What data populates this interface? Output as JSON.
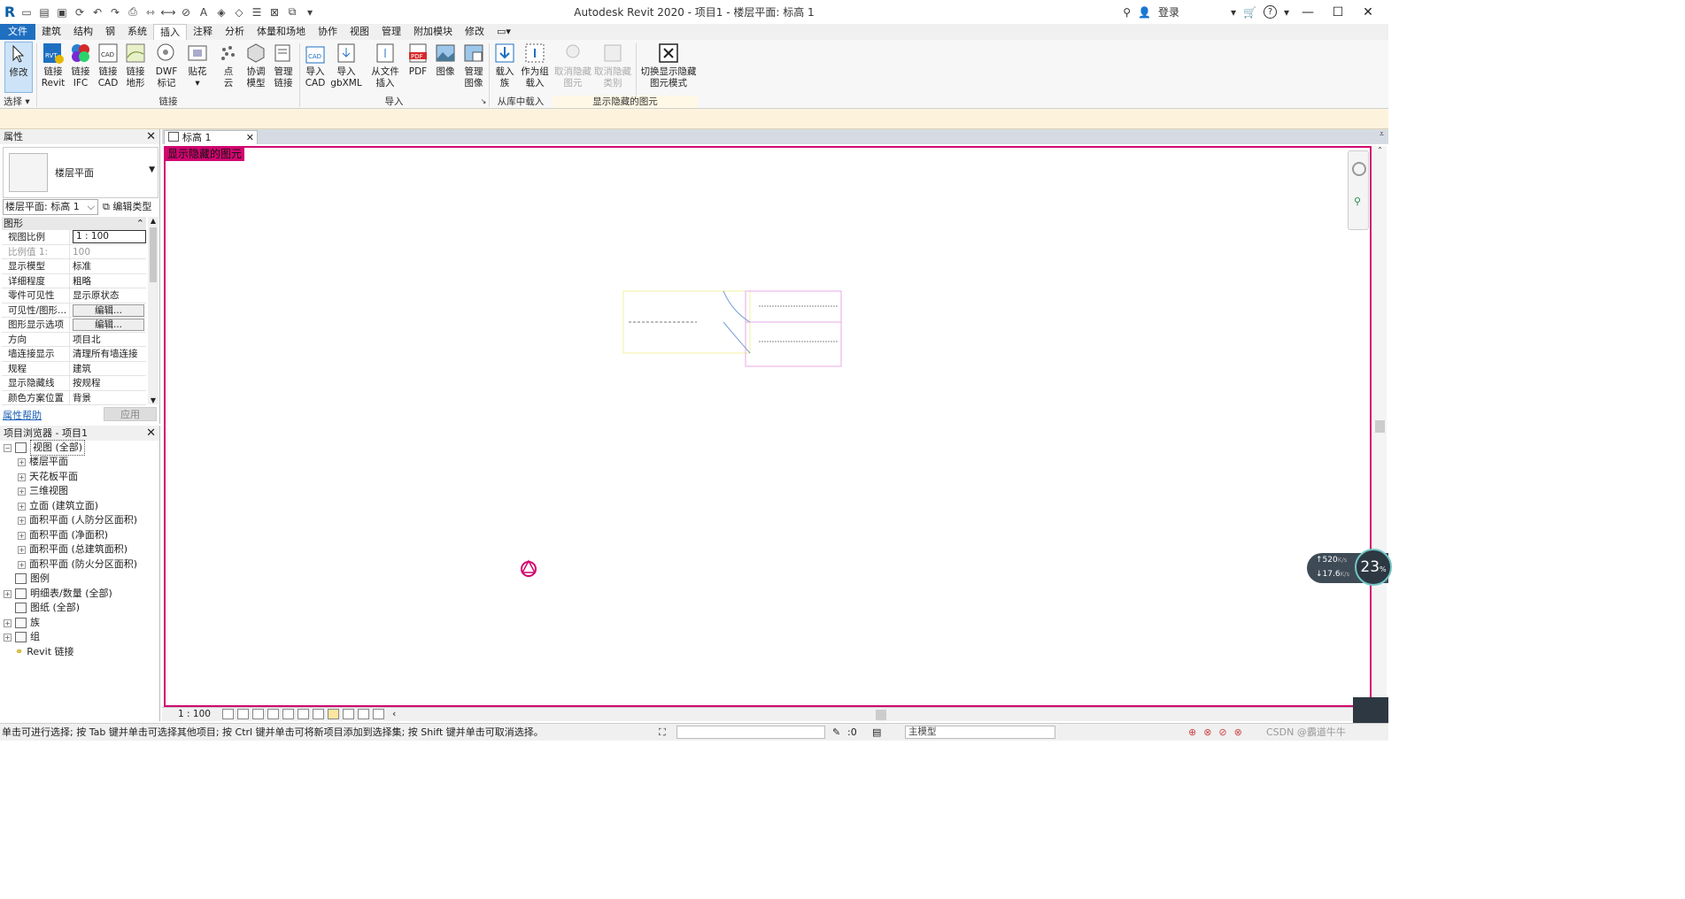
{
  "titlebar": {
    "title": "Autodesk Revit 2020 - 项目1 - 楼层平面: 标高 1",
    "login": "登录",
    "help": "?"
  },
  "tabs": [
    "文件",
    "建筑",
    "结构",
    "钢",
    "系统",
    "插入",
    "注释",
    "分析",
    "体量和场地",
    "协作",
    "视图",
    "管理",
    "附加模块",
    "修改"
  ],
  "ribbon": {
    "modify": "修改",
    "select_label": "选择",
    "buttons": [
      {
        "id": "link-revit",
        "label1": "链接",
        "label2": "Revit"
      },
      {
        "id": "link-ifc",
        "label1": "链接",
        "label2": "IFC"
      },
      {
        "id": "link-cad",
        "label1": "链接",
        "label2": "CAD"
      },
      {
        "id": "link-topo",
        "label1": "链接",
        "label2": "地形"
      },
      {
        "id": "dwf",
        "label1": "DWF",
        "label2": "标记"
      },
      {
        "id": "decal",
        "label1": "贴花",
        "label2": ""
      },
      {
        "id": "point-cloud",
        "label1": "点",
        "label2": "云"
      },
      {
        "id": "coord-model",
        "label1": "协调",
        "label2": "模型"
      },
      {
        "id": "manage-links",
        "label1": "管理",
        "label2": "链接"
      },
      {
        "id": "import-cad",
        "label1": "导入",
        "label2": "CAD"
      },
      {
        "id": "import-gbxml",
        "label1": "导入",
        "label2": "gbXML"
      },
      {
        "id": "insert-from-file",
        "label1": "从文件",
        "label2": "插入"
      },
      {
        "id": "pdf",
        "label1": "PDF",
        "label2": ""
      },
      {
        "id": "image",
        "label1": "图像",
        "label2": ""
      },
      {
        "id": "manage-images",
        "label1": "管理",
        "label2": "图像"
      },
      {
        "id": "load-family",
        "label1": "载入",
        "label2": "族"
      },
      {
        "id": "load-as-group",
        "label1": "作为组",
        "label2": "载入"
      },
      {
        "id": "unhide-element",
        "label1": "取消隐藏",
        "label2": "图元"
      },
      {
        "id": "unhide-category",
        "label1": "取消隐藏",
        "label2": "类别"
      },
      {
        "id": "toggle-reveal",
        "label1": "切换显示隐藏",
        "label2": "图元模式"
      }
    ],
    "panels": {
      "link": "链接",
      "import": "导入",
      "load_from_library": "从库中载入",
      "reveal_hidden": "显示隐藏的图元"
    }
  },
  "properties": {
    "title": "属性",
    "type_name": "楼层平面",
    "view_selector": "楼层平面: 标高 1",
    "edit_type": "编辑类型",
    "group": "图形",
    "rows": [
      {
        "k": "视图比例",
        "v": "1 : 100"
      },
      {
        "k": "比例值 1:",
        "v": "100"
      },
      {
        "k": "显示模型",
        "v": "标准"
      },
      {
        "k": "详细程度",
        "v": "粗略"
      },
      {
        "k": "零件可见性",
        "v": "显示原状态"
      },
      {
        "k": "可见性/图形...",
        "v": "编辑..."
      },
      {
        "k": "图形显示选项",
        "v": "编辑..."
      },
      {
        "k": "方向",
        "v": "项目北"
      },
      {
        "k": "墙连接显示",
        "v": "清理所有墙连接"
      },
      {
        "k": "规程",
        "v": "建筑"
      },
      {
        "k": "显示隐藏线",
        "v": "按规程"
      },
      {
        "k": "颜色方案位置",
        "v": "背景"
      }
    ],
    "help": "属性帮助",
    "apply": "应用"
  },
  "browser": {
    "title": "项目浏览器 - 项目1",
    "items": [
      {
        "label": "视图 (全部)"
      },
      {
        "label": "楼层平面"
      },
      {
        "label": "天花板平面"
      },
      {
        "label": "三维视图"
      },
      {
        "label": "立面 (建筑立面)"
      },
      {
        "label": "面积平面 (人防分区面积)"
      },
      {
        "label": "面积平面 (净面积)"
      },
      {
        "label": "面积平面 (总建筑面积)"
      },
      {
        "label": "面积平面 (防火分区面积)"
      },
      {
        "label": "图例"
      },
      {
        "label": "明细表/数量 (全部)"
      },
      {
        "label": "图纸 (全部)"
      },
      {
        "label": "族"
      },
      {
        "label": "组"
      },
      {
        "label": "Revit 链接"
      }
    ]
  },
  "view": {
    "tab": "标高 1",
    "hidden_banner": "显示隐藏的图元",
    "scale": "1 : 100"
  },
  "netspeed": {
    "up": "520",
    "down": "17.6",
    "unit": "K/s",
    "pct": "23"
  },
  "status": {
    "message": "单击可进行选择; 按 Tab 键并单击可选择其他项目; 按 Ctrl 键并单击可将新项目添加到选择集; 按 Shift 键并单击可取消选择。",
    "zero": ":0",
    "model": "主模型",
    "watermark": "CSDN @霸道牛牛"
  },
  "colors": {
    "accent": "#1f6fc1",
    "reveal": "#d1066f",
    "optionbar": "#fdf3dd"
  }
}
